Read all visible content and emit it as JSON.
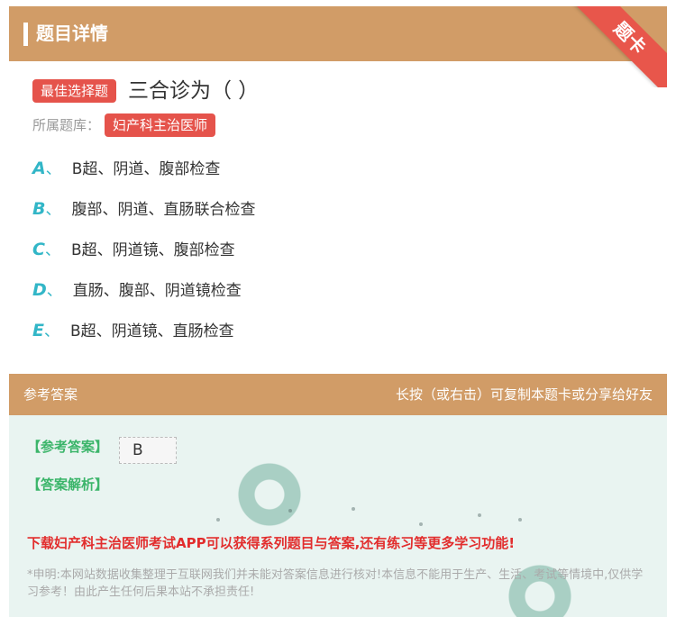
{
  "header": {
    "title": "题目详情"
  },
  "ribbon": {
    "label": "题卡"
  },
  "question": {
    "type_badge": "最佳选择题",
    "text": "三合诊为（ ）",
    "bank_label": "所属题库：",
    "bank_name": "妇产科主治医师"
  },
  "options": [
    {
      "letter": "A",
      "sep": "、",
      "text": "B超、阴道、腹部检查"
    },
    {
      "letter": "B",
      "sep": "、",
      "text": "腹部、阴道、直肠联合检查"
    },
    {
      "letter": "C",
      "sep": "、",
      "text": "B超、阴道镜、腹部检查"
    },
    {
      "letter": "D",
      "sep": "、",
      "text": "直肠、腹部、阴道镜检查"
    },
    {
      "letter": "E",
      "sep": "、",
      "text": "B超、阴道镜、直肠检查"
    }
  ],
  "answer": {
    "head_left": "参考答案",
    "head_right": "长按（或右击）可复制本题卡或分享给好友",
    "answer_label": "【参考答案】",
    "answer_value": "B",
    "analysis_label": "【答案解析】",
    "download_text": "下载妇产科主治医师考试APP可以获得系列题目与答案,还有练习等更多学习功能!",
    "disclaimer": "*申明:本网站数据收集整理于互联网我们并未能对答案信息进行核对!本信息不能用于生产、生活、考试等情境中,仅供学习参考！由此产生任何后果本站不承担责任!"
  },
  "colors": {
    "accent": "#d19c67",
    "badge": "#e5534b",
    "option_letter": "#32b6c7",
    "green": "#3bb56a",
    "download": "#e22d2d"
  }
}
